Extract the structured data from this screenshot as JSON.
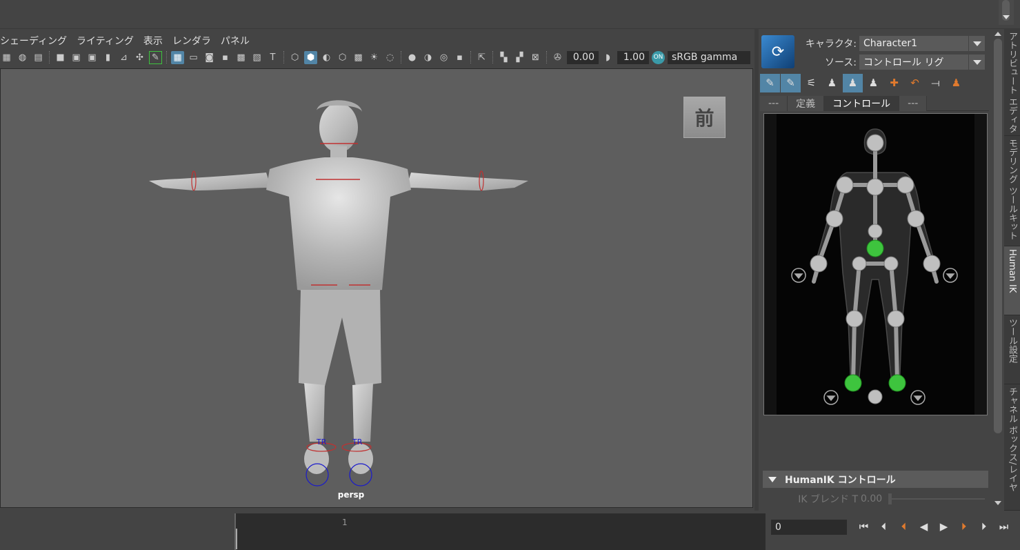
{
  "viewport": {
    "menu": [
      "シェーディング",
      "ライティング",
      "表示",
      "レンダラ",
      "パネル"
    ],
    "toolbar": {
      "exposure_value": "0.00",
      "gamma_value": "1.00",
      "color_space": "sRGB gamma"
    },
    "camera_label": "persp",
    "viewcube_label": "前",
    "rig_labels": [
      "TR",
      "TR"
    ]
  },
  "human_ik": {
    "character_label": "キャラクタ:",
    "character_value": "Character1",
    "source_label": "ソース:",
    "source_value": "コントロール リグ",
    "tabs": [
      {
        "label": "---",
        "active": false
      },
      {
        "label": "定義",
        "active": false
      },
      {
        "label": "コントロール",
        "active": true
      },
      {
        "label": "---",
        "active": false
      }
    ],
    "section_title": "HumanIK コントロール",
    "ik_blend_label": "IK ブレンド T",
    "ik_blend_value": "0.00"
  },
  "side_tabs": [
    "アトリビュート エディタ",
    "モデリング ツールキット",
    "Human IK",
    "ツール設定",
    "チャネル ボックス/レイヤ"
  ],
  "timeline": {
    "tick_label": "1",
    "current_frame": "0"
  },
  "colors": {
    "accent": "#5285a6",
    "effector_active": "#3ec43e",
    "effector_default": "#b8b8b8",
    "viewport_bg": "#5e5e5e",
    "figure_bg": "#1e1e1e",
    "transport_marker": "#e07a2e"
  },
  "icons": {
    "hik_logo": "humanik-logo-icon",
    "transport": [
      "go-to-start-icon",
      "step-back-icon",
      "step-back-key-icon",
      "play-backward-icon",
      "play-forward-icon",
      "step-forward-key-icon",
      "step-forward-icon",
      "go-to-end-icon"
    ]
  }
}
